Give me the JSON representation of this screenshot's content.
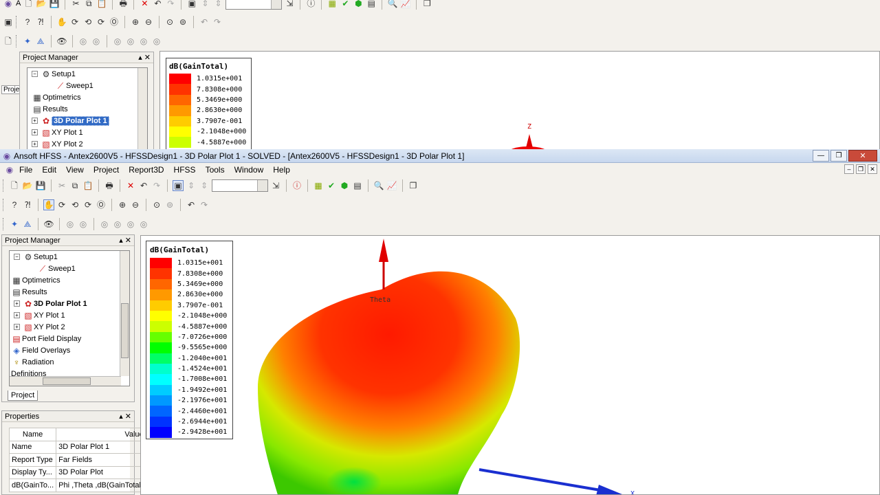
{
  "bg_window": {
    "title_letter": "A",
    "project_manager_title": "Project Manager",
    "tree": [
      {
        "label": "Setup1"
      },
      {
        "label": "Sweep1"
      },
      {
        "label": "Optimetrics"
      },
      {
        "label": "Results"
      },
      {
        "label": "3D Polar Plot 1"
      },
      {
        "label": "XY Plot 1"
      },
      {
        "label": "XY Plot 2"
      }
    ],
    "side_tab": "Proje",
    "legend_title": "dB(GainTotal)",
    "legend_values": [
      "1.0315e+001",
      "7.8308e+000",
      "5.3469e+000",
      "2.8630e+000",
      "3.7907e-001",
      "-2.1048e+000",
      "-4.5887e+000"
    ],
    "axis_z": "Z"
  },
  "main_window": {
    "title": "Ansoft HFSS - Antex2600V5 - HFSSDesign1 - 3D Polar Plot 1 - SOLVED - [Antex2600V5 - HFSSDesign1 - 3D Polar Plot 1]",
    "menu": [
      "File",
      "Edit",
      "View",
      "Project",
      "Report3D",
      "HFSS",
      "Tools",
      "Window",
      "Help"
    ],
    "project_manager_title": "Project Manager",
    "tree": [
      {
        "label": "Setup1"
      },
      {
        "label": "Sweep1"
      },
      {
        "label": "Optimetrics"
      },
      {
        "label": "Results"
      },
      {
        "label": "3D Polar Plot 1"
      },
      {
        "label": "XY Plot 1"
      },
      {
        "label": "XY Plot 2"
      },
      {
        "label": "Port Field Display"
      },
      {
        "label": "Field Overlays"
      },
      {
        "label": "Radiation"
      },
      {
        "label": "Definitions"
      }
    ],
    "project_tab": "Project",
    "properties_title": "Properties",
    "properties_columns": [
      "Name",
      "Value"
    ],
    "properties_rows": [
      {
        "name": "Name",
        "value": "3D Polar Plot 1"
      },
      {
        "name": "Report Type",
        "value": "Far Fields"
      },
      {
        "name": "Display Ty...",
        "value": "3D Polar Plot"
      },
      {
        "name": "dB(GainTo...",
        "value": "Phi ,Theta ,dB(GainTotal)"
      }
    ],
    "legend_title": "dB(GainTotal)",
    "legend_values": [
      "1.0315e+001",
      "7.8308e+000",
      "5.3469e+000",
      "2.8630e+000",
      "3.7907e-001",
      "-2.1048e+000",
      "-4.5887e+000",
      "-7.0726e+000",
      "-9.5565e+000",
      "-1.2040e+001",
      "-1.4524e+001",
      "-1.7008e+001",
      "-1.9492e+001",
      "-2.1976e+001",
      "-2.4460e+001",
      "-2.6944e+001",
      "-2.9428e+001"
    ],
    "legend_colors": [
      "#ff0000",
      "#ff3300",
      "#ff6600",
      "#ff9900",
      "#ffcc00",
      "#ffff00",
      "#ccff00",
      "#66ff00",
      "#00ff00",
      "#00ff66",
      "#00ffcc",
      "#00ffff",
      "#00ccff",
      "#0099ff",
      "#0066ff",
      "#0033ff",
      "#0000ff"
    ],
    "theta_label": "Theta",
    "axis_x": "X"
  }
}
